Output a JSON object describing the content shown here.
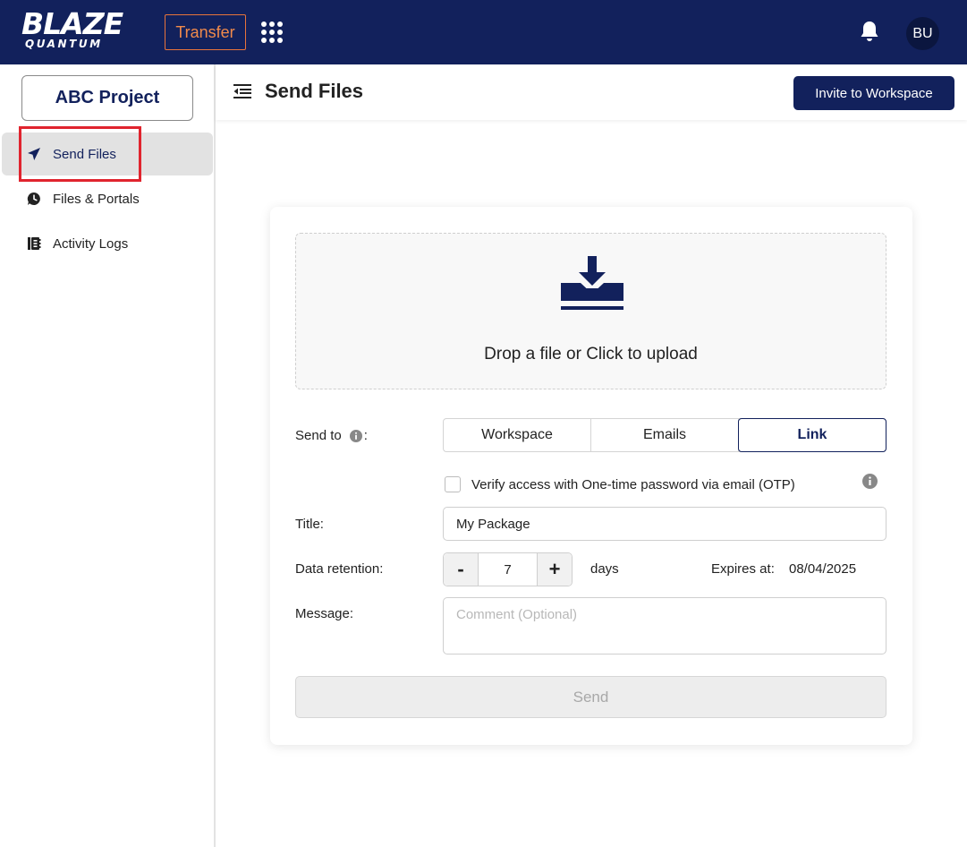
{
  "brand": {
    "logo_main": "BLAZE",
    "logo_sub": "QUANTUM"
  },
  "topbar": {
    "transfer_label": "Transfer",
    "apps_icon": "apps-grid-icon",
    "bell_icon": "bell-icon",
    "avatar_initials": "BU"
  },
  "sidebar": {
    "project_label": "ABC Project",
    "items": [
      {
        "label": "Send Files",
        "icon": "send-icon",
        "active": true
      },
      {
        "label": "Files & Portals",
        "icon": "clock-chat-icon",
        "active": false
      },
      {
        "label": "Activity Logs",
        "icon": "log-book-icon",
        "active": false
      }
    ]
  },
  "header": {
    "title": "Send Files",
    "invite_label": "Invite to Workspace"
  },
  "upload": {
    "drop_text": "Drop a file or Click to upload",
    "icon": "download-tray-icon"
  },
  "form": {
    "send_to_label": "Send to",
    "send_to_suffix": ":",
    "send_to_options": [
      "Workspace",
      "Emails",
      "Link"
    ],
    "send_to_selected": "Link",
    "otp_label": "Verify access with One-time password via email (OTP)",
    "otp_checked": false,
    "title_label": "Title:",
    "title_value": "My Package",
    "retention_label": "Data retention:",
    "retention_value": "7",
    "retention_minus": "-",
    "retention_plus": "+",
    "retention_unit": "days",
    "expires_label": "Expires at:",
    "expires_value": "08/04/2025",
    "message_label": "Message:",
    "message_placeholder": "Comment (Optional)",
    "send_label": "Send"
  },
  "colors": {
    "brand_navy": "#12215c",
    "accent_orange": "#e8743b",
    "highlight_red": "#e0242e"
  }
}
